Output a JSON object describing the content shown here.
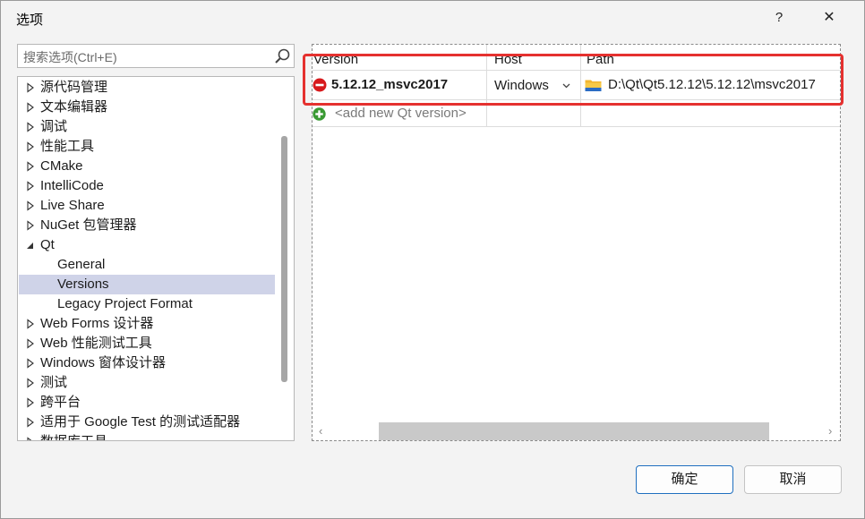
{
  "window": {
    "title": "选项",
    "help_label": "?",
    "close_label": "✕"
  },
  "search": {
    "placeholder": "搜索选项(Ctrl+E)",
    "value": "",
    "icon": "search-icon"
  },
  "tree": {
    "items": [
      {
        "label": "源代码管理",
        "expander": "collapsed"
      },
      {
        "label": "文本编辑器",
        "expander": "collapsed"
      },
      {
        "label": "调试",
        "expander": "collapsed"
      },
      {
        "label": "性能工具",
        "expander": "collapsed"
      },
      {
        "label": "CMake",
        "expander": "collapsed"
      },
      {
        "label": "IntelliCode",
        "expander": "collapsed"
      },
      {
        "label": "Live Share",
        "expander": "collapsed"
      },
      {
        "label": "NuGet 包管理器",
        "expander": "collapsed"
      },
      {
        "label": "Qt",
        "expander": "expanded"
      },
      {
        "label": "General",
        "expander": "none",
        "child": true
      },
      {
        "label": "Versions",
        "expander": "none",
        "child": true,
        "selected": true
      },
      {
        "label": "Legacy Project Format",
        "expander": "none",
        "child": true
      },
      {
        "label": "Web Forms 设计器",
        "expander": "collapsed"
      },
      {
        "label": "Web 性能测试工具",
        "expander": "collapsed"
      },
      {
        "label": "Windows 窗体设计器",
        "expander": "collapsed"
      },
      {
        "label": "测试",
        "expander": "collapsed"
      },
      {
        "label": "跨平台",
        "expander": "collapsed"
      },
      {
        "label": "适用于 Google Test 的测试适配器",
        "expander": "collapsed"
      },
      {
        "label": "数据库工具",
        "expander": "collapsed"
      }
    ]
  },
  "versions": {
    "columns": [
      "Version",
      "Host",
      "Path"
    ],
    "rows": [
      {
        "version": "5.12.12_msvc2017",
        "host": "Windows",
        "path": "D:\\Qt\\Qt5.12.12\\5.12.12\\msvc2017"
      }
    ],
    "add_placeholder": "<add new Qt version>",
    "accent": "#e5312f"
  },
  "buttons": {
    "ok": "确定",
    "cancel": "取消"
  }
}
